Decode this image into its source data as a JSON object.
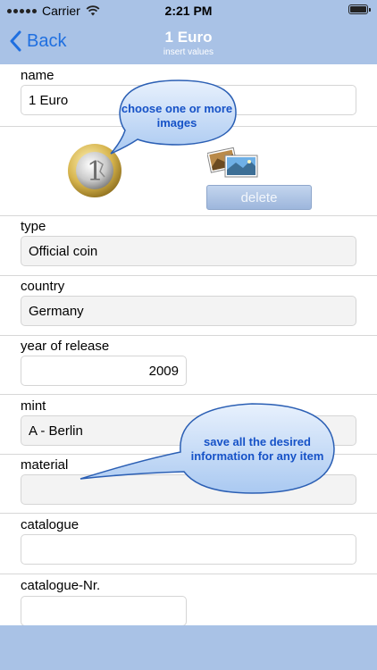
{
  "status": {
    "carrier": "Carrier",
    "time": "2:21 PM"
  },
  "nav": {
    "back_label": "Back",
    "title": "1 Euro",
    "subtitle": "insert values"
  },
  "form": {
    "name": {
      "label": "name",
      "value": "1 Euro"
    },
    "images": {
      "delete_label": "delete"
    },
    "type": {
      "label": "type",
      "value": "Official coin"
    },
    "country": {
      "label": "country",
      "value": "Germany"
    },
    "year": {
      "label": "year of release",
      "value": "2009"
    },
    "mint": {
      "label": "mint",
      "value": "A - Berlin"
    },
    "material": {
      "label": "material",
      "value": ""
    },
    "catalogue": {
      "label": "catalogue",
      "value": ""
    },
    "catalogue_nr": {
      "label": "catalogue-Nr.",
      "value": ""
    }
  },
  "tips": {
    "images": "choose one or more images",
    "save": "save all the desired information for any item"
  },
  "colors": {
    "bar": "#a9c2e6",
    "accent": "#1f6fe0",
    "tip_text": "#1652c7"
  }
}
